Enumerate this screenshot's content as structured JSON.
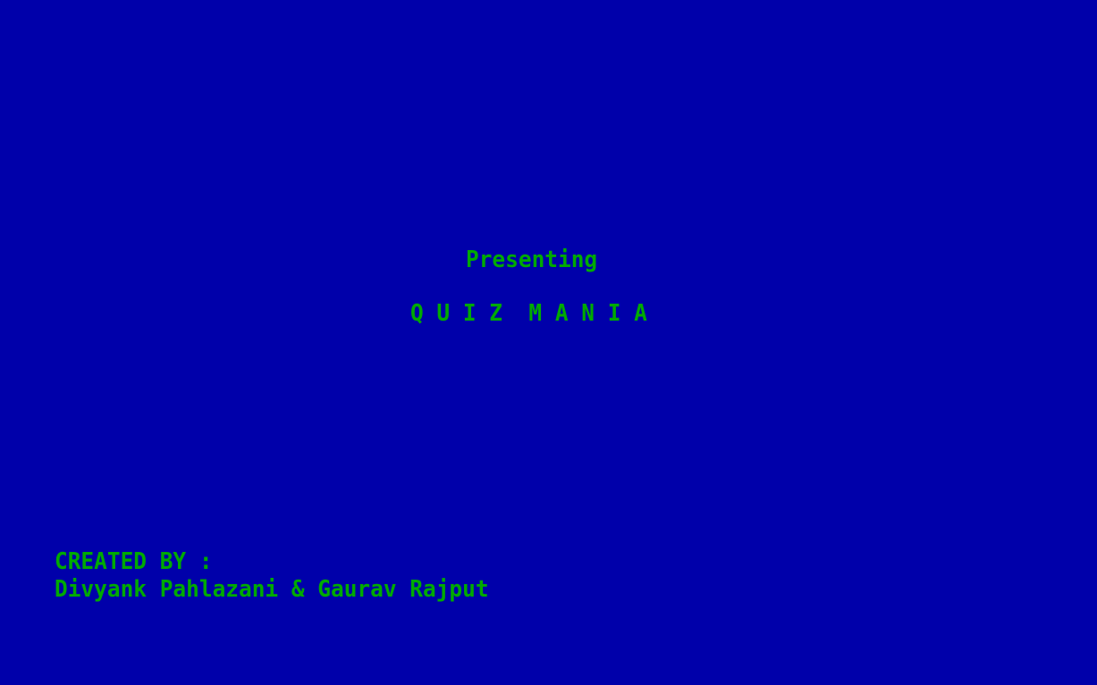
{
  "splash": {
    "intro": "Presenting",
    "title": "Q U I Z  M A N I A",
    "created_by_label": "CREATED BY :",
    "authors": "Divyank Pahlazani & Gaurav Rajput"
  },
  "colors": {
    "background": "#0000aa",
    "text": "#00aa00"
  }
}
